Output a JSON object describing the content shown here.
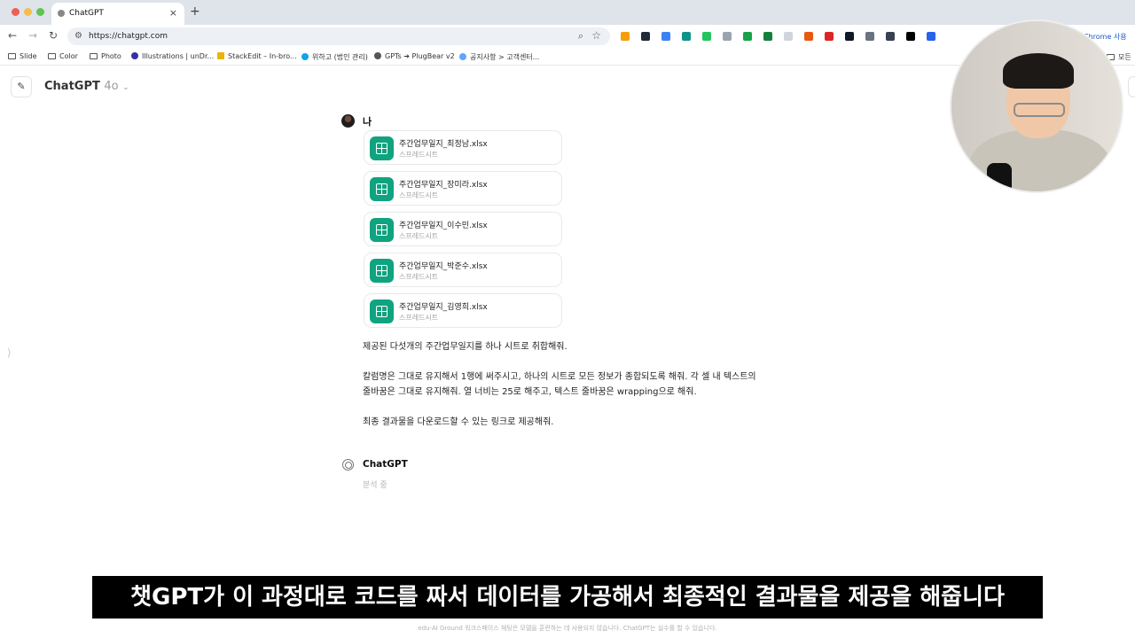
{
  "browser": {
    "tab_title": "ChatGPT",
    "tab_close": "×",
    "new_tab": "+",
    "url": "https://chatgpt.com",
    "chrome_note": "Chrome 사용 가",
    "bookmarks": [
      {
        "label": "Slide",
        "icon": "folder-icon"
      },
      {
        "label": "Color",
        "icon": "folder-icon"
      },
      {
        "label": "Photo",
        "icon": "folder-icon"
      },
      {
        "label": "Illustrations | unDr...",
        "icon": "site-icon"
      },
      {
        "label": "StackEdit – In-bro...",
        "icon": "site-icon"
      },
      {
        "label": "위하고 (법인 관리)",
        "icon": "site-icon"
      },
      {
        "label": "GPTs ➔ PlugBear v2",
        "icon": "globe-icon"
      },
      {
        "label": "공지사항 > 고객센터...",
        "icon": "site-icon"
      },
      {
        "label": "모든",
        "icon": "folder-icon"
      }
    ]
  },
  "app": {
    "model_name": "ChatGPT",
    "model_version": "4o"
  },
  "conversation": {
    "user_name": "나",
    "files": [
      {
        "name": "주간업무일지_최정남.xlsx",
        "type": "스프레드시트"
      },
      {
        "name": "주간업무일지_장미라.xlsx",
        "type": "스프레드시트"
      },
      {
        "name": "주간업무일지_이수민.xlsx",
        "type": "스프레드시트"
      },
      {
        "name": "주간업무일지_박준수.xlsx",
        "type": "스프레드시트"
      },
      {
        "name": "주간업무일지_김영희.xlsx",
        "type": "스프레드시트"
      }
    ],
    "message_lines": [
      "제공된 다섯개의 주간업무일지를 하나 시트로 취합해줘.",
      "칼럼명은 그대로 유지해서 1행에 써주시고, 하나의 시트로 모든 정보가 종합되도록 해줘. 각 셀 내 텍스트의",
      "줄바꿈은 그대로 유지해줘. 열 너비는 25로 해주고, 텍스트 줄바꿈은 wrapping으로 해줘.",
      "최종 결과물을 다운로드할 수 있는 링크로 제공해줘."
    ],
    "assistant_name": "ChatGPT",
    "assistant_status": "분석 중"
  },
  "subtitle": "챗GPT가 이 과정대로 코드를 짜서 데이터를 가공해서 최종적인 결과물을 제공을 해줍니다",
  "footer": "edu-AI Ground 워크스페이스 채팅은 모델을 훈련하는 데 사용되지 않습니다. ChatGPT는 실수를 할 수 있습니다.",
  "colors": {
    "file_icon_bg": "#10a37f",
    "subtitle_bg": "#000000",
    "title_bar_bg": "#dfe3ea"
  }
}
